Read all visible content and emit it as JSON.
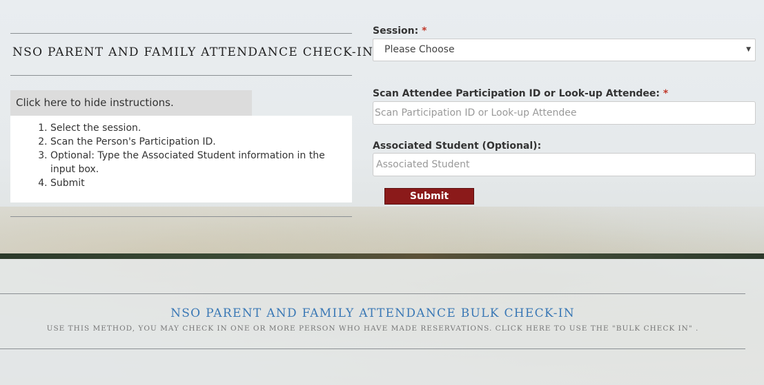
{
  "checkin": {
    "title": "NSO PARENT AND FAMILY ATTENDANCE CHECK-IN",
    "instructions_toggle": "Click here to hide instructions.",
    "instructions": [
      "Select the session.",
      "Scan the Person's Participation ID.",
      "Optional: Type the Associated Student information in the input box.",
      "Submit"
    ]
  },
  "form": {
    "session_label": "Session:",
    "session_required": "*",
    "session_value": "Please Choose",
    "scan_label": "Scan Attendee Participation ID or Look-up Attendee:",
    "scan_required": "*",
    "scan_placeholder": "Scan Participation ID or Look-up Attendee",
    "student_label": "Associated Student (Optional):",
    "student_placeholder": "Associated Student",
    "submit_label": "Submit"
  },
  "bulk": {
    "title": "NSO PARENT AND FAMILY ATTENDANCE BULK CHECK-IN",
    "subtitle": "USE THIS METHOD, YOU MAY CHECK IN ONE OR MORE PERSON WHO HAVE MADE RESERVATIONS. CLICK HERE TO USE THE \"BULK CHECK IN\" ."
  },
  "colors": {
    "submit_bg": "#8b1a1a",
    "required": "#c0392b",
    "bulk_title": "#3a78b5"
  }
}
